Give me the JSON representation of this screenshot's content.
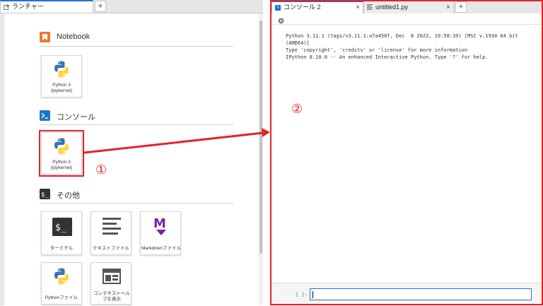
{
  "left_tabs": {
    "launcher_tab": "ランチャー",
    "add": "+"
  },
  "launcher": {
    "notebook": {
      "title": "Notebook",
      "kernel_card": "Python 3\n(ipykernel)"
    },
    "console": {
      "title": "コンソール",
      "kernel_card": "Python 3\n(ipykernel)"
    },
    "other": {
      "title": "その他",
      "cards": [
        "ターミナル",
        "テキストファイル",
        "Markdownファイル",
        "Pythonファイル",
        "コンテキストヘルプを表示"
      ]
    }
  },
  "right_tabs": {
    "console_tab": "コンソール 2",
    "file_tab": "untitled1.py",
    "close": "×",
    "add": "+"
  },
  "console": {
    "output": "Python 3.11.1 (tags/v3.11.1:a7a450f, Dec  6 2022, 19:58:39) [MSC v.1934 64 bit\n(AMD64)]\nType 'copyright', 'credits' or 'license' for more information\nIPython 8.10.0 -- An enhanced Interactive Python. Type '?' for help.",
    "prompt": "[ ]:",
    "input_value": ""
  },
  "annotations": {
    "marker_1": "①",
    "marker_2": "②"
  },
  "colors": {
    "accent": "#1976d2",
    "highlight_red": "#e6222a",
    "notebook_orange": "#f37726",
    "console_blue": "#1976d2",
    "terminal_dark": "#333333",
    "markdown_purple": "#7b1fa2"
  }
}
